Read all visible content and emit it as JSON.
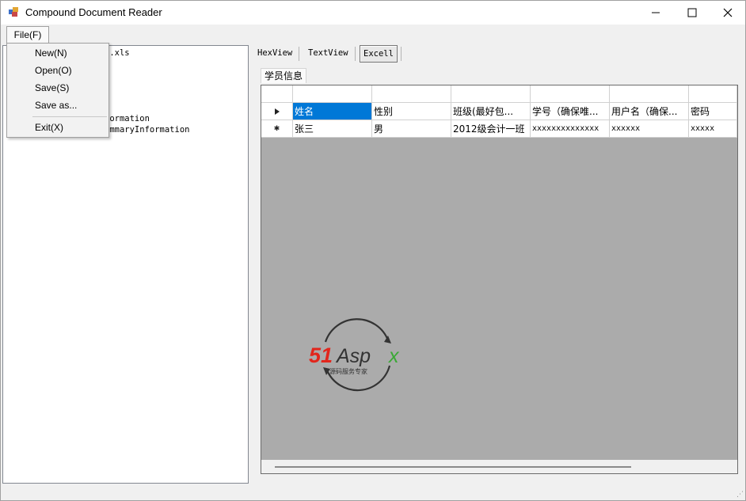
{
  "window": {
    "title": "Compound Document Reader",
    "minimize_glyph": "─",
    "maximize_glyph": "☐",
    "close_glyph": "✕"
  },
  "menu": {
    "file_label": "File(F)",
    "items": [
      "New(N)",
      "Open(O)",
      "Save(S)",
      "Save as...",
      "Exit(X)"
    ]
  },
  "tree": {
    "lines": [
      "e.xls",
      "formation",
      "ummaryInformation"
    ]
  },
  "tabs": [
    "HexView",
    "TextView",
    "Excell"
  ],
  "active_tab": "Excell",
  "sheet": {
    "name": "学员信息",
    "columns": [
      "姓名",
      "性别",
      "班级(最好包...",
      "学号（确保唯...",
      "用户名（确保...",
      "密码"
    ],
    "rows": [
      [
        "张三",
        "男",
        "2012级会计一班",
        "xxxxxxxxxxxxxx",
        "xxxxxx",
        "xxxxx"
      ]
    ],
    "current_row_marker": "▶",
    "new_row_marker": "✱"
  },
  "watermark": {
    "brand": "51Aspx",
    "tagline": "源码服务专家",
    "colors": {
      "red": "#e2261c",
      "green": "#3aa935",
      "dark": "#333333"
    }
  },
  "colors": {
    "selection": "#0078d7",
    "grid_background": "#ababab"
  }
}
